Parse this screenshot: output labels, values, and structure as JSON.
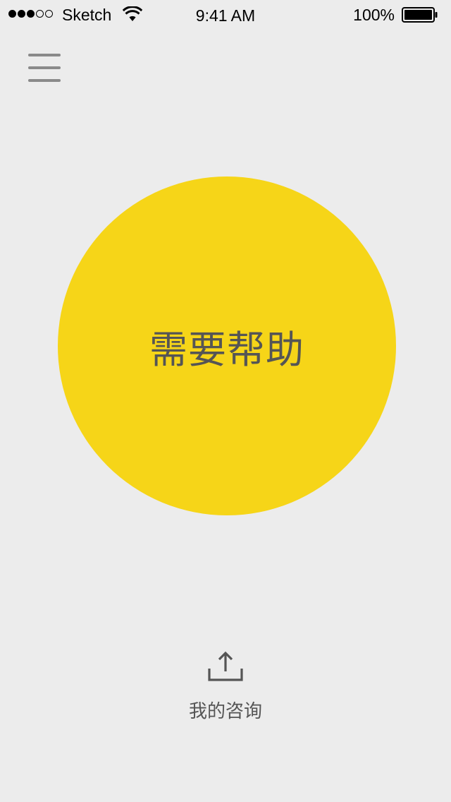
{
  "status_bar": {
    "carrier": "Sketch",
    "time": "9:41 AM",
    "battery": "100%",
    "signal_icon": "signal-dots-icon",
    "wifi_icon": "wifi-icon",
    "battery_icon": "battery-icon"
  },
  "menu": {
    "icon": "hamburger-menu-icon"
  },
  "help_button": {
    "label": "需要帮助",
    "color": "#f6d518"
  },
  "consult": {
    "icon": "upload-icon",
    "label": "我的咨询"
  },
  "colors": {
    "background": "#ececec",
    "text_gray": "#555555",
    "menu_gray": "#8a8a8a",
    "accent_yellow": "#f6d518"
  }
}
